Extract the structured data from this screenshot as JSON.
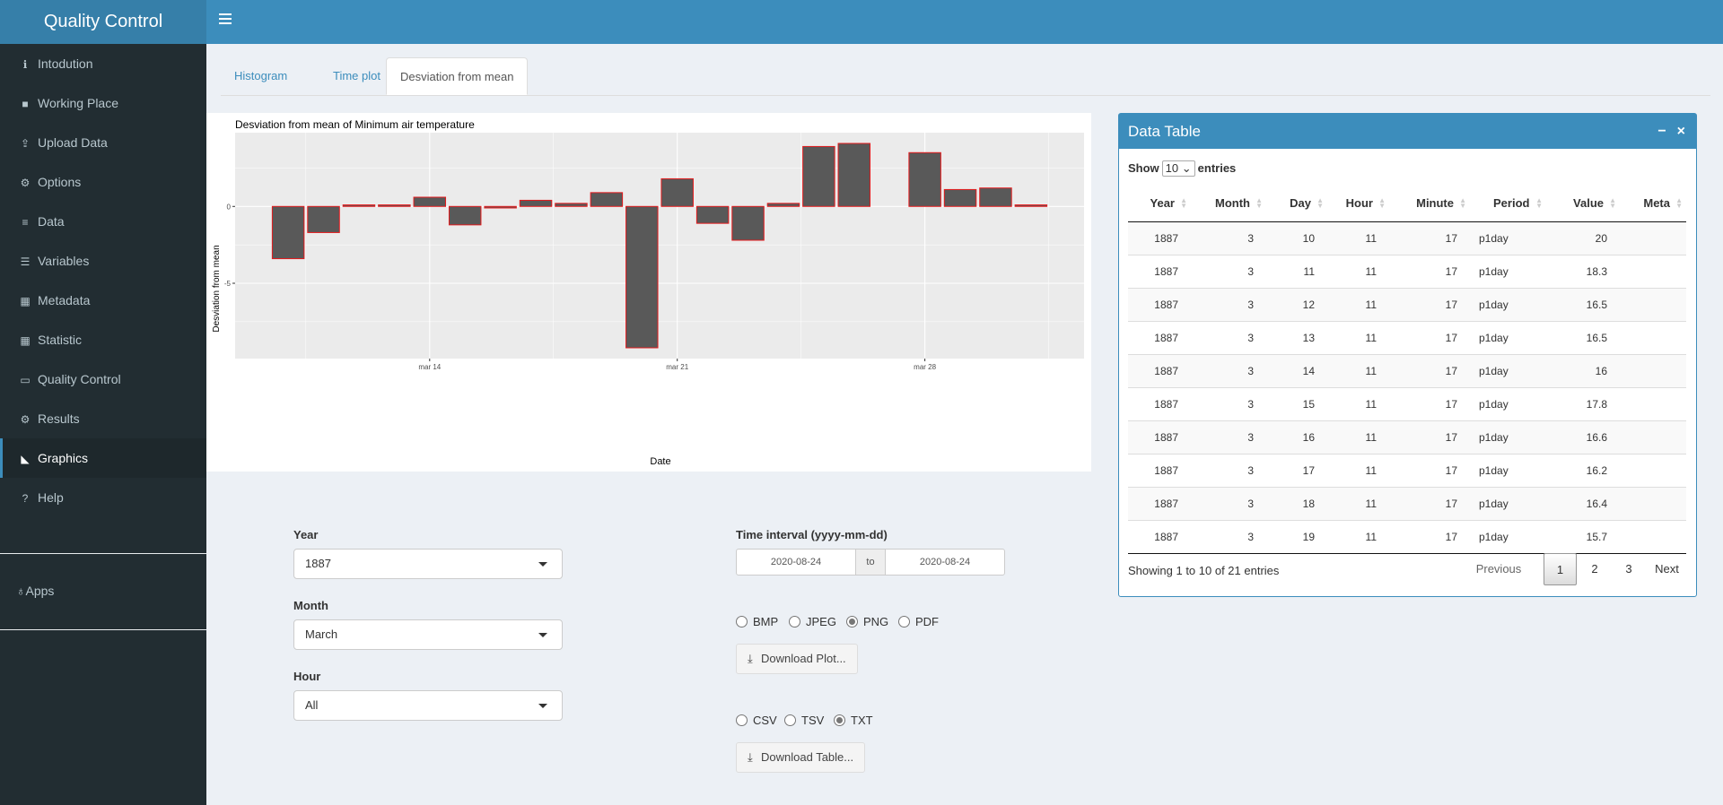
{
  "app": {
    "title": "Quality Control"
  },
  "sidebar": {
    "items": [
      {
        "label": "Intodution",
        "icon": "info-icon"
      },
      {
        "label": "Working Place",
        "icon": "briefcase-icon"
      },
      {
        "label": "Upload Data",
        "icon": "upload-icon"
      },
      {
        "label": "Options",
        "icon": "gears-icon"
      },
      {
        "label": "Data",
        "icon": "database-icon"
      },
      {
        "label": "Variables",
        "icon": "list-icon"
      },
      {
        "label": "Metadata",
        "icon": "table-icon"
      },
      {
        "label": "Statistic",
        "icon": "table-icon"
      },
      {
        "label": "Quality Control",
        "icon": "laptop-icon"
      },
      {
        "label": "Results",
        "icon": "gears-icon"
      },
      {
        "label": "Graphics",
        "icon": "area-chart-icon",
        "active": true
      },
      {
        "label": "Help",
        "icon": "question-icon"
      }
    ],
    "apps_label": "Apps"
  },
  "tabs": [
    {
      "label": "Histogram"
    },
    {
      "label": "Time plot"
    },
    {
      "label": "Desviation from mean",
      "active": true
    }
  ],
  "chart_data": {
    "type": "bar",
    "title": "Desviation from mean of Minimum air temperature",
    "xlabel": "Date",
    "ylabel": "Desviation from mean",
    "x": [
      "1887-03-10",
      "1887-03-11",
      "1887-03-12",
      "1887-03-13",
      "1887-03-14",
      "1887-03-15",
      "1887-03-16",
      "1887-03-17",
      "1887-03-18",
      "1887-03-19",
      "1887-03-20",
      "1887-03-21",
      "1887-03-22",
      "1887-03-23",
      "1887-03-24",
      "1887-03-25",
      "1887-03-26",
      "1887-03-28",
      "1887-03-29",
      "1887-03-30",
      "1887-03-31"
    ],
    "values": [
      -3.4,
      -1.7,
      0.1,
      0.1,
      0.6,
      -1.2,
      -0.1,
      0.4,
      0.2,
      0.9,
      -9.2,
      1.8,
      -1.1,
      -2.2,
      0.2,
      3.9,
      4.1,
      3.5,
      1.1,
      1.2,
      0.1
    ],
    "xticks": [
      "mar 14",
      "mar 21",
      "mar 28"
    ],
    "yticks": [
      0,
      -5
    ],
    "ylim": [
      -9.9,
      4.8
    ],
    "bar_fill": "#595959",
    "bar_stroke": "#e41a1c",
    "panel_bg": "#ebebeb",
    "grid": true
  },
  "form": {
    "year": {
      "label": "Year",
      "value": "1887"
    },
    "month": {
      "label": "Month",
      "value": "March"
    },
    "hour": {
      "label": "Hour",
      "value": "All"
    },
    "interval": {
      "label": "Time interval (yyyy-mm-dd)",
      "start": "2020-08-24",
      "sep": "to",
      "end": "2020-08-24"
    },
    "plot_formats": [
      {
        "label": "BMP",
        "checked": false
      },
      {
        "label": "JPEG",
        "checked": false
      },
      {
        "label": "PNG",
        "checked": true
      },
      {
        "label": "PDF",
        "checked": false
      }
    ],
    "download_plot": "Download Plot...",
    "table_formats": [
      {
        "label": "CSV",
        "checked": false
      },
      {
        "label": "TSV",
        "checked": false
      },
      {
        "label": "TXT",
        "checked": true
      }
    ],
    "download_table": "Download Table..."
  },
  "table": {
    "title": "Data Table",
    "show_label": "Show",
    "length": "10",
    "entries_label": "entries",
    "columns": [
      "Year",
      "Month",
      "Day",
      "Hour",
      "Minute",
      "Period",
      "Value",
      "Meta"
    ],
    "rows": [
      [
        "1887",
        "3",
        "10",
        "11",
        "17",
        "p1day",
        "20",
        ""
      ],
      [
        "1887",
        "3",
        "11",
        "11",
        "17",
        "p1day",
        "18.3",
        ""
      ],
      [
        "1887",
        "3",
        "12",
        "11",
        "17",
        "p1day",
        "16.5",
        ""
      ],
      [
        "1887",
        "3",
        "13",
        "11",
        "17",
        "p1day",
        "16.5",
        ""
      ],
      [
        "1887",
        "3",
        "14",
        "11",
        "17",
        "p1day",
        "16",
        ""
      ],
      [
        "1887",
        "3",
        "15",
        "11",
        "17",
        "p1day",
        "17.8",
        ""
      ],
      [
        "1887",
        "3",
        "16",
        "11",
        "17",
        "p1day",
        "16.6",
        ""
      ],
      [
        "1887",
        "3",
        "17",
        "11",
        "17",
        "p1day",
        "16.2",
        ""
      ],
      [
        "1887",
        "3",
        "18",
        "11",
        "17",
        "p1day",
        "16.4",
        ""
      ],
      [
        "1887",
        "3",
        "19",
        "11",
        "17",
        "p1day",
        "15.7",
        ""
      ]
    ],
    "info": "Showing 1 to 10 of 21 entries",
    "pager": {
      "previous": "Previous",
      "pages": [
        "1",
        "2",
        "3"
      ],
      "next": "Next",
      "current": "1"
    }
  },
  "colors": {
    "header": "#3c8dbc",
    "logo_bg": "#367fa9",
    "sidebar": "#222d32",
    "sidebar_active": "#1e282c",
    "content_bg": "#ecf0f5"
  }
}
